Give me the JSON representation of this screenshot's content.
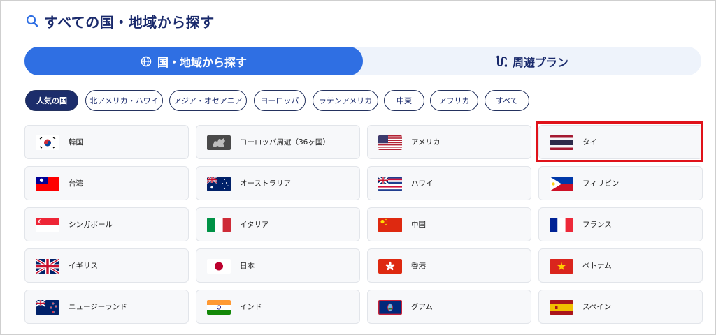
{
  "heading": {
    "title": "すべての国・地域から探す"
  },
  "tabs": [
    {
      "label": "国・地域から探す"
    },
    {
      "label": "周遊プラン"
    }
  ],
  "chips": [
    {
      "label": "人気の国"
    },
    {
      "label": "北アメリカ・ハワイ"
    },
    {
      "label": "アジア・オセアニア"
    },
    {
      "label": "ヨーロッパ"
    },
    {
      "label": "ラテンアメリカ"
    },
    {
      "label": "中東"
    },
    {
      "label": "アフリカ"
    },
    {
      "label": "すべて"
    }
  ],
  "destinations": [
    {
      "name": "韓国"
    },
    {
      "name": "ヨーロッパ周遊（36ヶ国）"
    },
    {
      "name": "アメリカ"
    },
    {
      "name": "タイ"
    },
    {
      "name": "台湾"
    },
    {
      "name": "オーストラリア"
    },
    {
      "name": "ハワイ"
    },
    {
      "name": "フィリピン"
    },
    {
      "name": "シンガポール"
    },
    {
      "name": "イタリア"
    },
    {
      "name": "中国"
    },
    {
      "name": "フランス"
    },
    {
      "name": "イギリス"
    },
    {
      "name": "日本"
    },
    {
      "name": "香港"
    },
    {
      "name": "ベトナム"
    },
    {
      "name": "ニュージーランド"
    },
    {
      "name": "インド"
    },
    {
      "name": "グアム"
    },
    {
      "name": "スペイン"
    }
  ],
  "colors": {
    "accent": "#2f6fe3",
    "navy": "#1c2d6b",
    "highlight": "#e0121a"
  }
}
